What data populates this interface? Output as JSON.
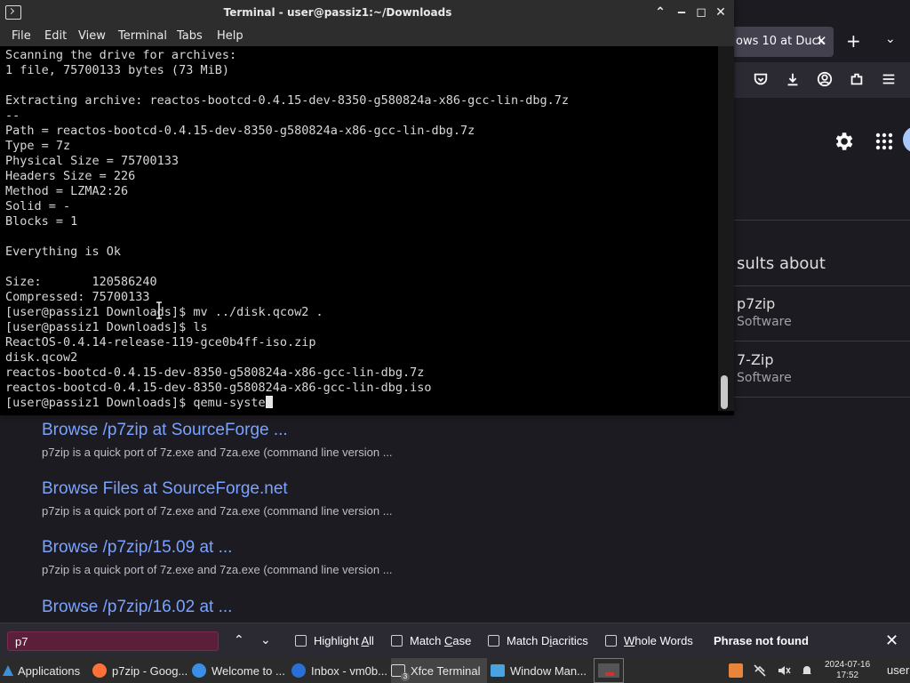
{
  "browser": {
    "tab": {
      "title": "ows 10 at Duck",
      "close": "✕"
    },
    "new_tab": "+",
    "tab_list": "⌄",
    "results_heading": "sults about",
    "side_results": [
      {
        "title": "p7zip",
        "subtitle": "Software"
      },
      {
        "title": "7-Zip",
        "subtitle": "Software"
      }
    ],
    "results": [
      {
        "link": "Browse /p7zip at SourceForge ...",
        "snippet": "p7zip is a quick port of 7z.exe and 7za.exe (command line version ..."
      },
      {
        "link": "Browse Files at SourceForge.net",
        "snippet": "p7zip is a quick port of 7z.exe and 7za.exe (command line version ..."
      },
      {
        "link": "Browse /p7zip/15.09 at ...",
        "snippet": "p7zip is a quick port of 7z.exe and 7za.exe (command line version ..."
      },
      {
        "link": "Browse /p7zip/16.02 at ...",
        "snippet": ""
      }
    ]
  },
  "terminal": {
    "title": "Terminal - user@passiz1:~/Downloads",
    "menu": [
      "File",
      "Edit",
      "View",
      "Terminal",
      "Tabs",
      "Help"
    ],
    "lines": [
      "Scanning the drive for archives:",
      "1 file, 75700133 bytes (73 MiB)",
      "",
      "Extracting archive: reactos-bootcd-0.4.15-dev-8350-g580824a-x86-gcc-lin-dbg.7z",
      "--",
      "Path = reactos-bootcd-0.4.15-dev-8350-g580824a-x86-gcc-lin-dbg.7z",
      "Type = 7z",
      "Physical Size = 75700133",
      "Headers Size = 226",
      "Method = LZMA2:26",
      "Solid = -",
      "Blocks = 1",
      "",
      "Everything is Ok",
      "",
      "Size:       120586240",
      "Compressed: 75700133",
      "[user@passiz1 Downloads]$ mv ../disk.qcow2 .",
      "[user@passiz1 Downloads]$ ls",
      "ReactOS-0.4.14-release-119-gce0b4ff-iso.zip",
      "disk.qcow2",
      "reactos-bootcd-0.4.15-dev-8350-g580824a-x86-gcc-lin-dbg.7z",
      "reactos-bootcd-0.4.15-dev-8350-g580824a-x86-gcc-lin-dbg.iso"
    ],
    "prompt": "[user@passiz1 Downloads]$ ",
    "current_input": "qemu-syste",
    "scroll_position": 0.98
  },
  "findbar": {
    "query": "p7",
    "prev": "⌃",
    "next": "⌄",
    "options": [
      {
        "pre": "Highlight ",
        "ul": "A",
        "post": "ll"
      },
      {
        "pre": "Match ",
        "ul": "C",
        "post": "ase"
      },
      {
        "pre": "Match D",
        "ul": "i",
        "post": "acritics"
      },
      {
        "pre": "",
        "ul": "W",
        "post": "hole Words"
      }
    ],
    "status": "Phrase not found",
    "close": "✕"
  },
  "taskbar": {
    "applications": "Applications",
    "windows": [
      {
        "label": "p7zip - Goog...",
        "color": "#ff7139"
      },
      {
        "label": "Welcome to ...",
        "color": "#3a8ee6"
      },
      {
        "label": "Inbox - vm0b...",
        "color": "#2a6fd6"
      },
      {
        "label": "Xfce Terminal",
        "badge": "3"
      },
      {
        "label": "Window Man...",
        "color": "#4aa3df"
      }
    ],
    "clock_date": "2024-07-16",
    "clock_time": "17:52",
    "user": "user"
  },
  "colors": {
    "accent": "#7aa3ff",
    "find_not_found": "#5b1f3a",
    "terminal_bg": "#000000"
  }
}
